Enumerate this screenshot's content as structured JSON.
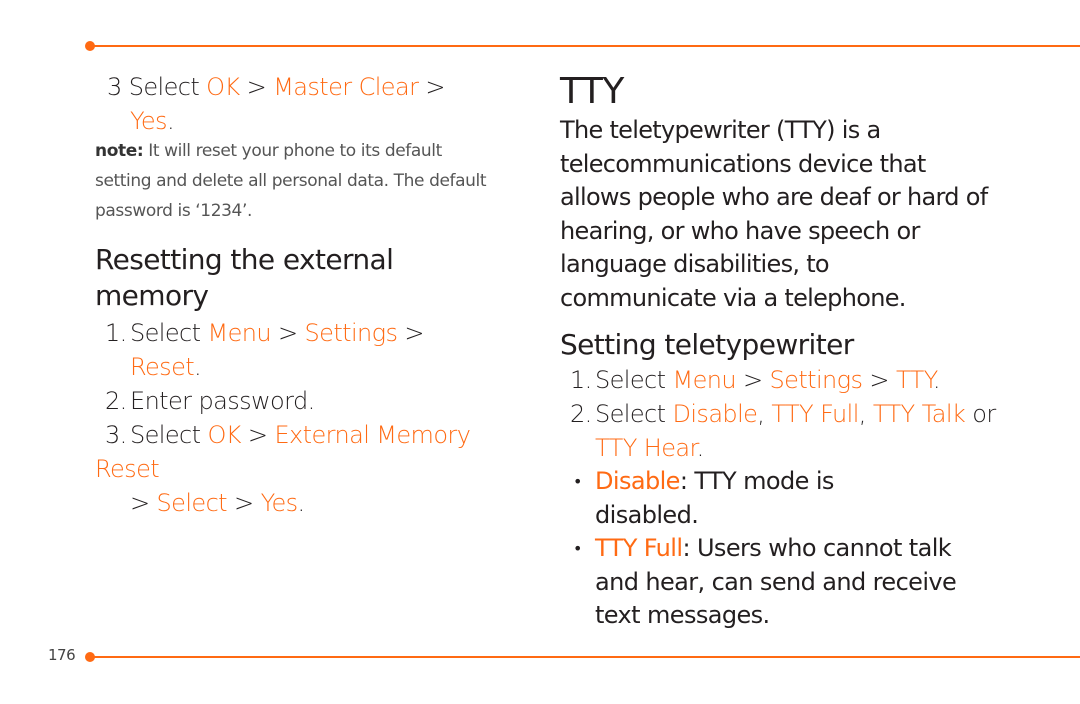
{
  "page_number": "176",
  "left": {
    "step3": {
      "num": "3",
      "pre": "Select ",
      "ok": "OK",
      "sep1": " > ",
      "master_clear": "Master Clear",
      "sep2": " >",
      "yes": "Yes",
      "end": "."
    },
    "note": {
      "label": "note:",
      "text": " It will reset your phone to its default setting and delete all personal data. The default password is ‘1234’."
    },
    "section_title": "Resetting the external memory",
    "steps": [
      {
        "num": "1.",
        "pre": "Select ",
        "a": "Menu",
        "s1": " > ",
        "b": "Settings",
        "s2": " >",
        "c": "Reset",
        "end": "."
      },
      {
        "num": "2.",
        "text": "Enter password."
      },
      {
        "num": "3.",
        "pre": "Select ",
        "a": "OK",
        "s1": " > ",
        "b": "External Memory Reset",
        "s2": " > ",
        "c": "Select",
        "s3": " > ",
        "d": "Yes",
        "end": "."
      }
    ]
  },
  "right": {
    "title": "TTY",
    "intro": "The teletypewriter (TTY) is a telecommunications device that allows people who are deaf or hard of hearing, or who have speech or language disabilities, to communicate via a telephone.",
    "section_title": "Setting teletypewriter",
    "steps": [
      {
        "num": "1.",
        "pre": "Select ",
        "a": "Menu",
        "s1": " > ",
        "b": "Settings",
        "s2": " > ",
        "c": "TTY",
        "end": "."
      },
      {
        "num": "2.",
        "pre": "Select ",
        "a": "Disable",
        "s1": ", ",
        "b": "TTY Full",
        "s2": ", ",
        "c": "TTY Talk",
        "s3": " or ",
        "d": "TTY Hear",
        "end": "."
      }
    ],
    "bullets": [
      {
        "term": "Disable",
        "text": ": TTY mode is disabled."
      },
      {
        "term": "TTY Full",
        "text": ": Users who cannot talk and hear, can send and receive text messages."
      }
    ]
  },
  "colors": {
    "accent": "#ff6a13",
    "text": "#231f20"
  }
}
